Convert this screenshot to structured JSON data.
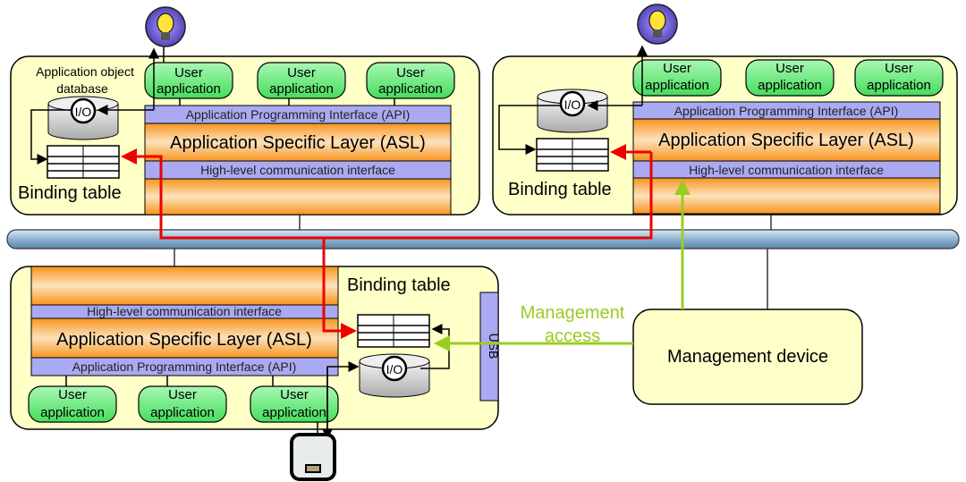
{
  "labels": {
    "user_application_line1": "User",
    "user_application_line2": "application",
    "api": "Application Programming Interface (API)",
    "asl": "Application Specific Layer (ASL)",
    "hlci": "High-level communication interface",
    "binding_table": "Binding table",
    "app_object_db_line1": "Application object",
    "app_object_db_line2": "database",
    "io": "I/O",
    "usb": "USB",
    "management_access_line1": "Management",
    "management_access_line2": "access",
    "management_device": "Management device"
  },
  "colors": {
    "node_fill": "#ffffc8",
    "api_bar": "#aaaaf2",
    "asl_orange": "#f7941d",
    "user_app_green": "#66ee77",
    "binding_link_red": "#ee0000",
    "management_green": "#99cc22",
    "bus_blue": "#8fb3d0",
    "lightbulb_circle": "#6655cc"
  },
  "icons": [
    "lightbulb-icon",
    "database-icon",
    "binding-table-icon",
    "device-icon"
  ]
}
